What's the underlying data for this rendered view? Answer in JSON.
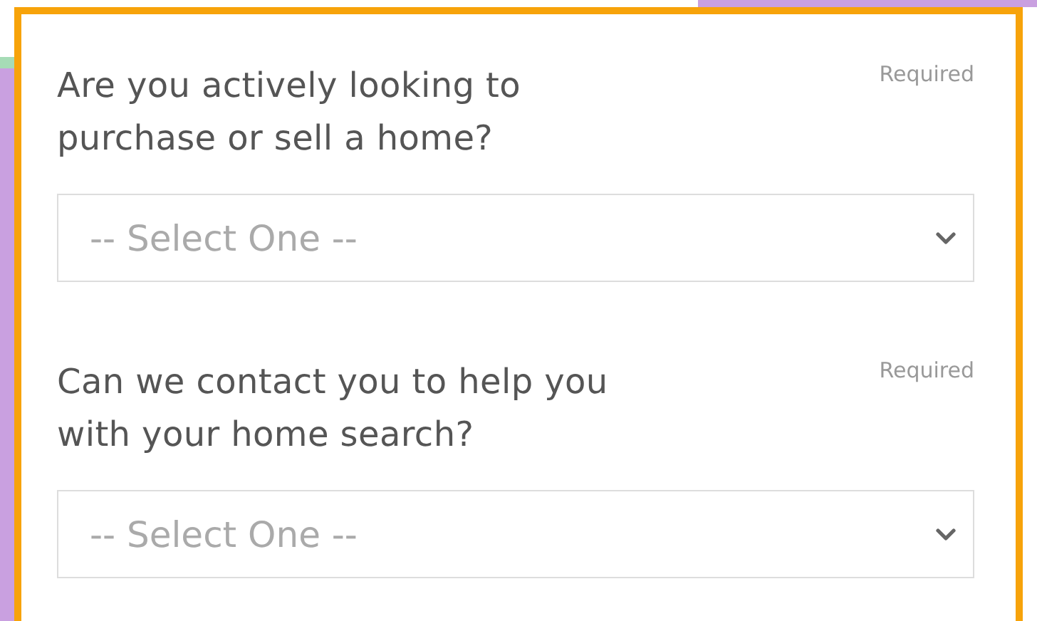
{
  "questions": [
    {
      "label": "Are you actively looking to purchase or sell a home?",
      "required": "Required",
      "select": {
        "value": "-- Select One --"
      }
    },
    {
      "label": "Can we contact you to help you with your home search?",
      "required": "Required",
      "select": {
        "value": "-- Select One --"
      }
    }
  ]
}
